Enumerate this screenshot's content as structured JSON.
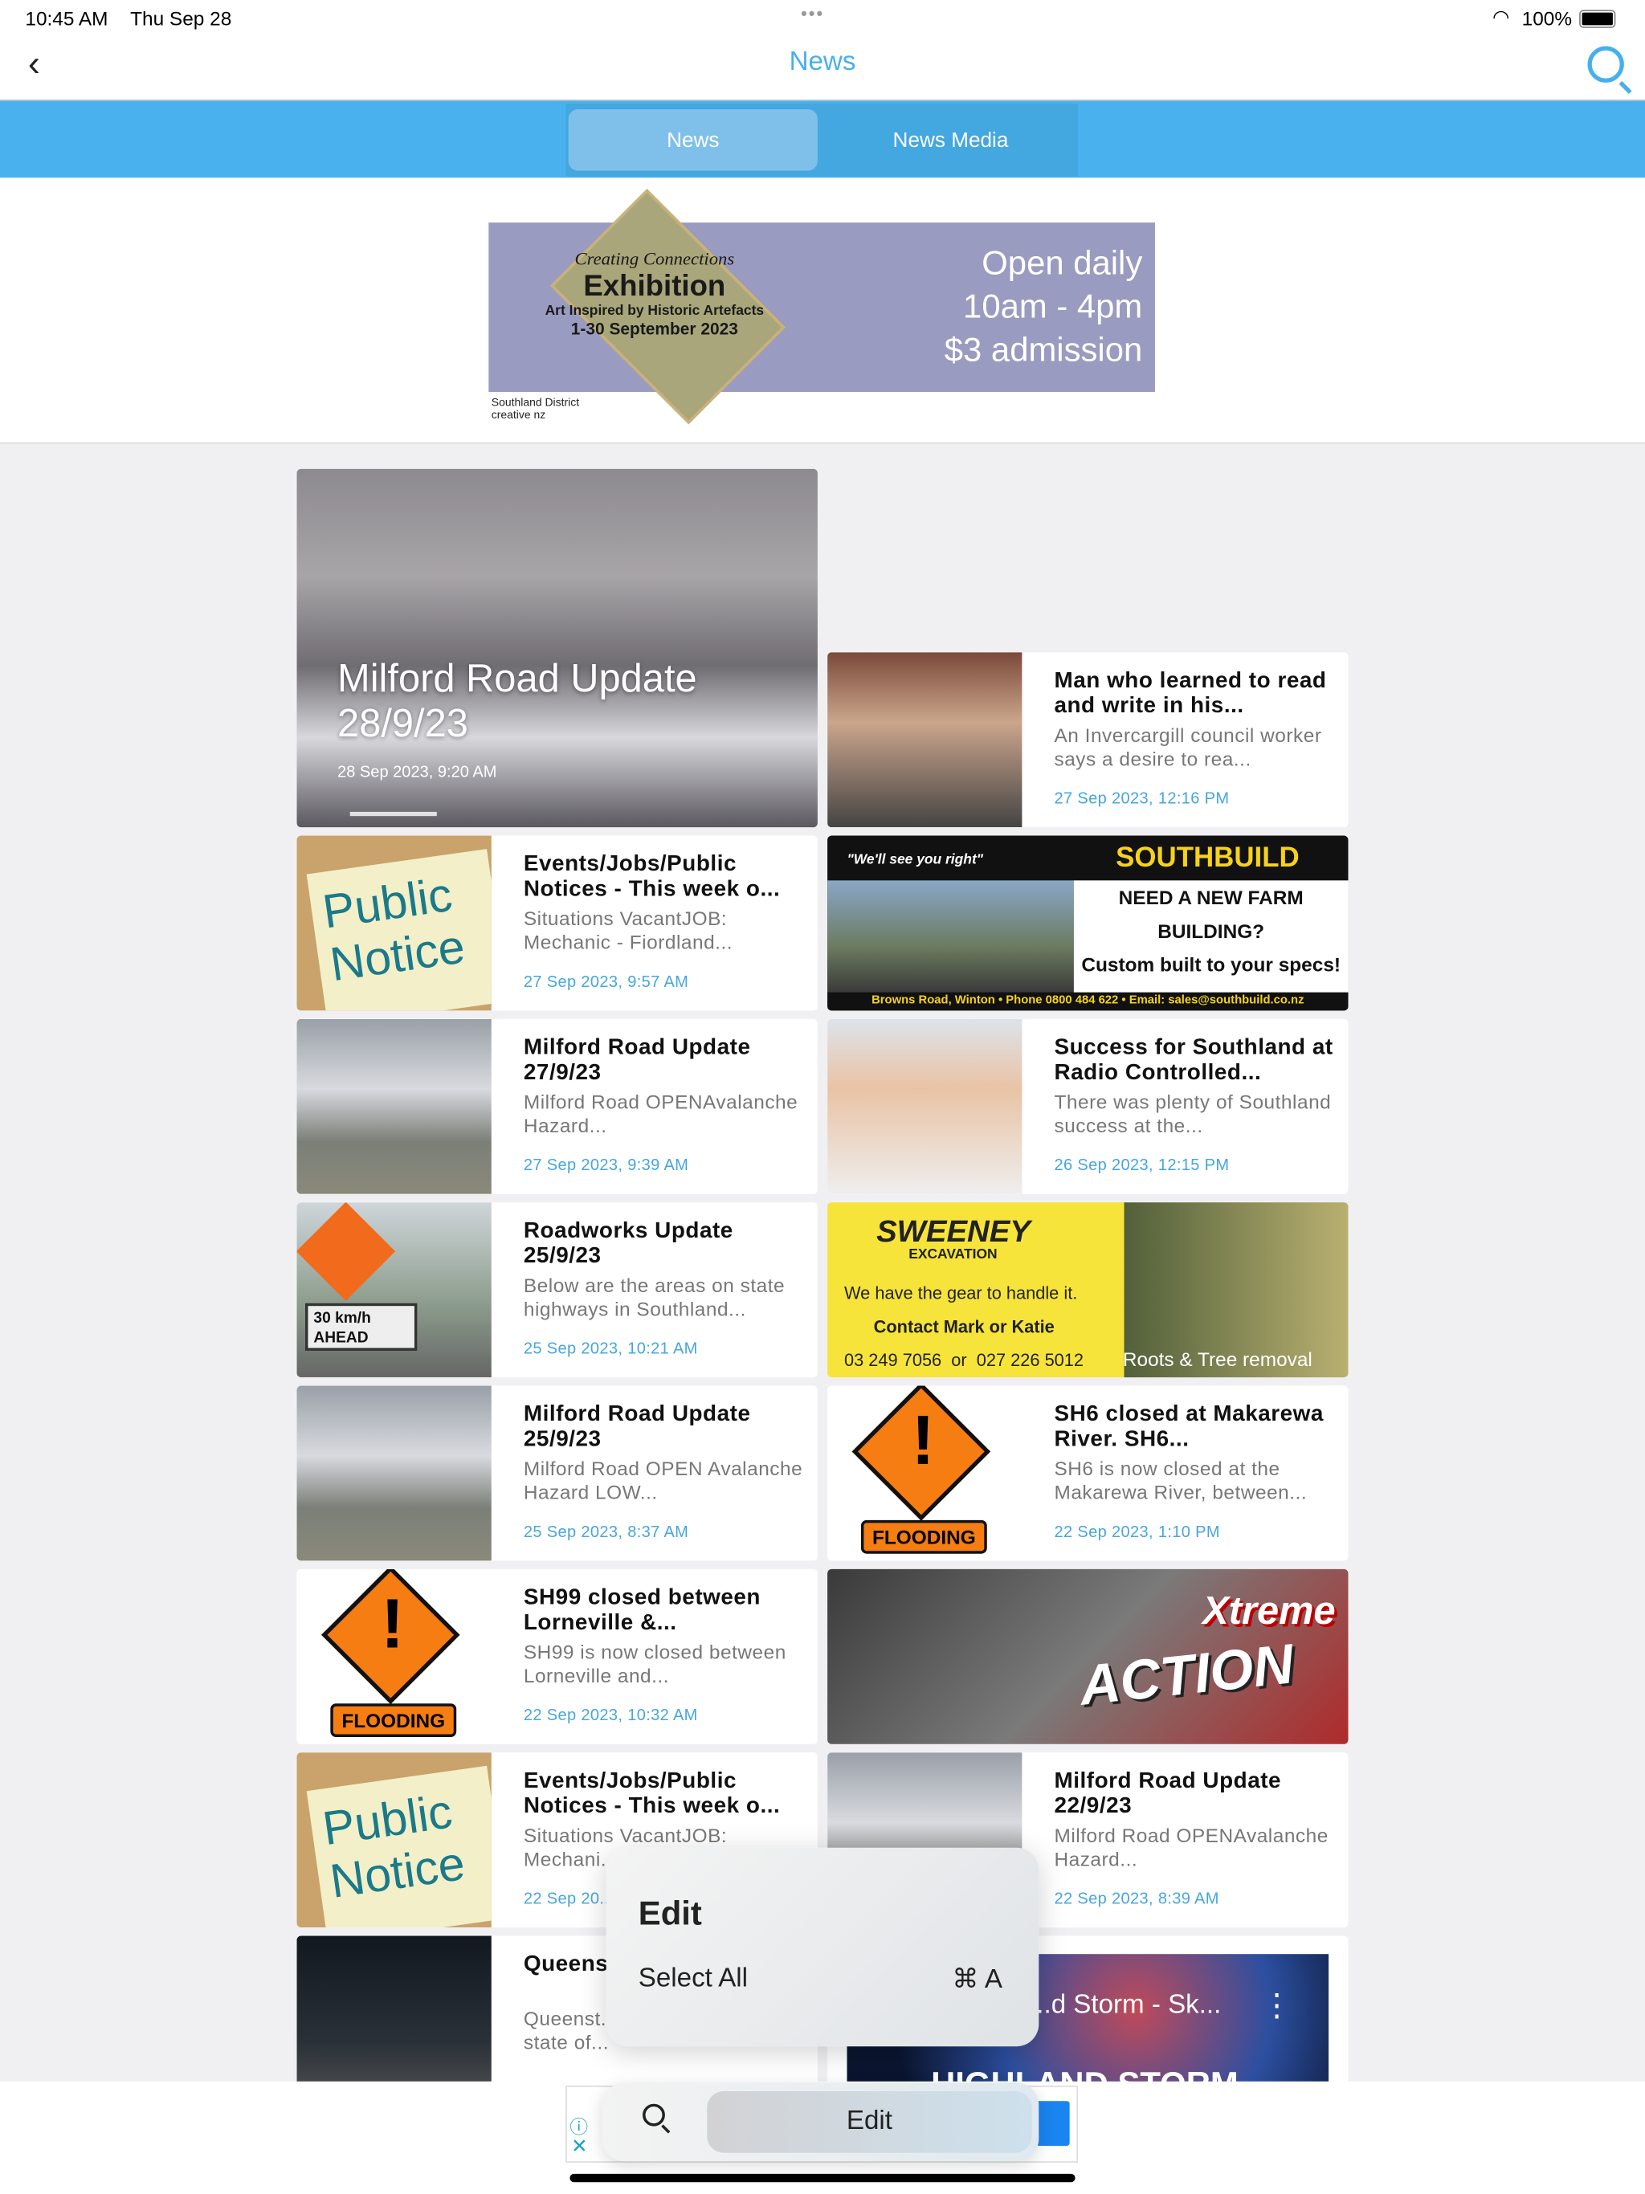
{
  "status_bar": {
    "time": "10:45 AM",
    "date": "Thu Sep 28",
    "battery": "100%",
    "dots": "•••"
  },
  "nav": {
    "title": "News",
    "back_icon": "chevron-left-icon",
    "search_icon": "search-icon"
  },
  "tabs": [
    {
      "label": "News",
      "selected": true
    },
    {
      "label": "News Media",
      "selected": false
    }
  ],
  "banner": {
    "line1": "Creating Connections",
    "line2": "Exhibition",
    "line3": "Art Inspired by Historic Artefacts",
    "line4": "1-30 September 2023",
    "right1": "Open daily",
    "right2": "10am - 4pm",
    "right3": "$3 admission",
    "logo": "Southland District creative nz"
  },
  "featured": {
    "title": "Milford Road Update 28/9/23",
    "date": "28 Sep 2023, 9:20 AM"
  },
  "left": [
    {
      "title": "Events/Jobs/Public Notices - This week o...",
      "desc": "Situations VacantJOB: Mechanic - Fiordland...",
      "date": "27 Sep 2023, 9:57 AM",
      "thumb_text": "Public Notice"
    },
    {
      "title": "Milford Road Update 27/9/23",
      "desc": "Milford Road OPENAvalanche Hazard...",
      "date": "27 Sep 2023, 9:39 AM"
    },
    {
      "title": "Roadworks Update 25/9/23",
      "desc": "Below are the areas on state highways in Southland...",
      "date": "25 Sep 2023, 10:21 AM",
      "thumb_text": "30 km/h AHEAD"
    },
    {
      "title": "Milford Road Update 25/9/23",
      "desc": "Milford Road OPEN Avalanche Hazard LOW...",
      "date": "25 Sep 2023, 8:37 AM"
    },
    {
      "title": "SH99 closed between Lorneville &...",
      "desc": "SH99 is now closed between Lorneville and...",
      "date": "22 Sep 2023, 10:32 AM",
      "thumb_text": "FLOODING"
    },
    {
      "title": "Events/Jobs/Public Notices - This week o...",
      "desc": "Situations VacantJOB: Mechani...",
      "date": "22 Sep 20...",
      "thumb_text": "Public Notice"
    },
    {
      "title": "Queens... State o...",
      "desc": "Queenst... Lewers declared a state of...",
      "date": ""
    }
  ],
  "right": [
    {
      "title": "Man who learned to read and write in his...",
      "desc": "An Invercargill council worker says a desire to rea...",
      "date": "27 Sep 2023, 12:16 PM"
    },
    {
      "title": "Success for Southland at Radio Controlled...",
      "desc": "There was plenty of Southland success at the...",
      "date": "26 Sep 2023, 12:15 PM"
    },
    {
      "title": "SH6 closed at Makarewa River. SH6...",
      "desc": "SH6 is now closed at the Makarewa River, between...",
      "date": "22 Sep 2023, 1:10 PM",
      "thumb_text": "FLOODING"
    },
    {
      "title": "Milford Road Update 22/9/23",
      "desc": "Milford Road OPENAvalanche Hazard...",
      "date": "22 Sep 2023, 8:39 AM"
    }
  ],
  "ads": {
    "southbuild": {
      "tagline": "\"We'll see you right\"",
      "brand": "SOUTHBUILD",
      "headline": "NEED A NEW FARM BUILDING?",
      "sub": "Custom built to your specs!",
      "footer": "Browns Road, Winton • Phone 0800 484 622 • Email: sales@southbuild.co.nz"
    },
    "sweeney": {
      "brand": "SWEENEY",
      "sub": "EXCAVATION",
      "line1": "We have the gear to handle it.",
      "line2": "Contact Mark or Katie",
      "phone": "03 249 7056  or  027 226 5012",
      "service": "Roots & Tree removal"
    },
    "xtreme": {
      "text1": "Xtreme",
      "text2": "ACTION"
    },
    "video": {
      "title": "...d Storm - Sk...",
      "overlay": "HIGHLAND STORM"
    }
  },
  "edit_menu": {
    "title": "Edit",
    "item": "Select All",
    "shortcut": "⌘ A"
  },
  "bottom_bar": {
    "edit_label": "Edit"
  }
}
